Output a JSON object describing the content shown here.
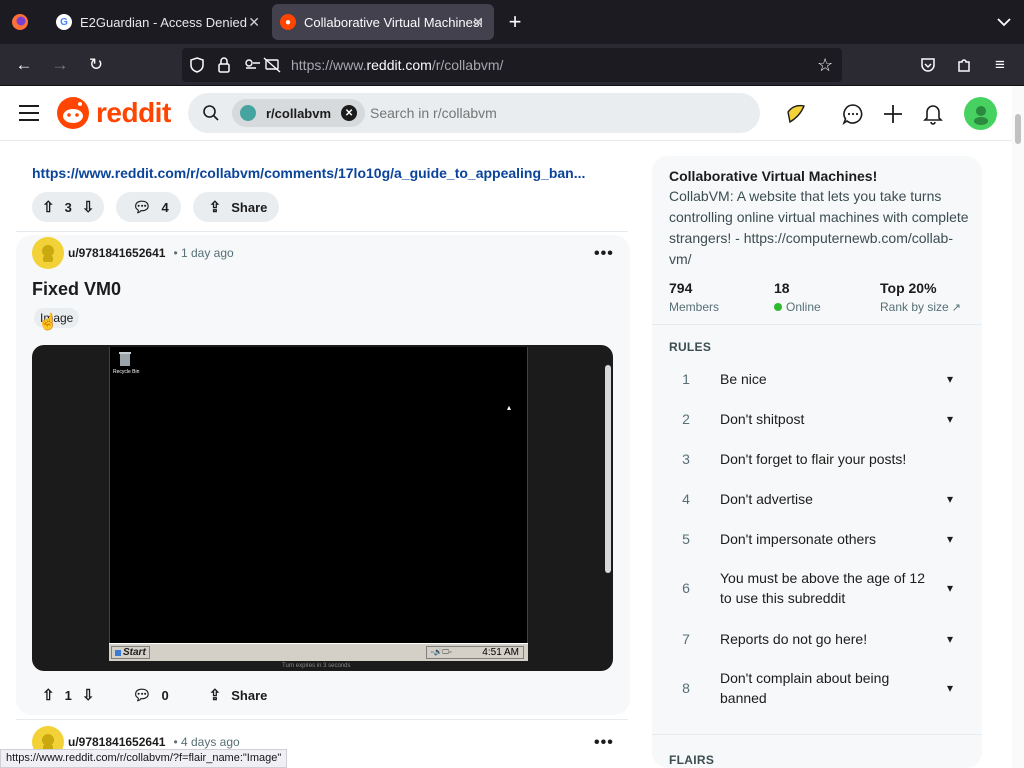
{
  "browser": {
    "tabs": [
      {
        "title": "E2Guardian - Access Denied",
        "active": false
      },
      {
        "title": "Collaborative Virtual Machines!",
        "active": true
      }
    ],
    "url": {
      "prefix": "https://www.",
      "domain": "reddit.com",
      "path": "/r/collabvm/"
    },
    "status_url": "https://www.reddit.com/r/collabvm/?f=flair_name:\"Image\""
  },
  "header": {
    "logo_text": "reddit",
    "search_chip": "r/collabvm",
    "search_placeholder": "Search in r/collabvm"
  },
  "feed": {
    "prev_post": {
      "link": "https://www.reddit.com/r/collabvm/comments/17lo10g/a_guide_to_appealing_ban...",
      "votes": "3",
      "comments": "4",
      "share": "Share"
    },
    "post": {
      "user": "u/9781841652641",
      "time": "• 1 day ago",
      "title": "Fixed VM0",
      "flair": "Image",
      "image": {
        "recycle_bin_label": "Recycle Bin",
        "start_label": "Start",
        "clock": "4:51 AM",
        "tray_icons": "▫🔊🖵▫",
        "caption": "Turn expires in 3 seconds"
      },
      "votes": "1",
      "comments": "0",
      "share": "Share"
    },
    "next_post": {
      "user": "u/9781841652641",
      "time": "• 4 days ago"
    }
  },
  "sidebar": {
    "title": "Collaborative Virtual Machines!",
    "description": "CollabVM: A website that lets you take turns controlling online virtual machines with complete strangers! - https://computernewb.com/collab-vm/",
    "stats": [
      {
        "value": "794",
        "label": "Members"
      },
      {
        "value": "18",
        "label": "Online"
      },
      {
        "value": "Top 20%",
        "label": "Rank by size"
      }
    ],
    "rules_heading": "RULES",
    "rules": [
      {
        "n": "1",
        "text": "Be nice",
        "expandable": true
      },
      {
        "n": "2",
        "text": "Don't shitpost",
        "expandable": true
      },
      {
        "n": "3",
        "text": "Don't forget to flair your posts!",
        "expandable": false
      },
      {
        "n": "4",
        "text": "Don't advertise",
        "expandable": true
      },
      {
        "n": "5",
        "text": "Don't impersonate others",
        "expandable": true
      },
      {
        "n": "6",
        "text": "You must be above the age of 12 to use this subreddit",
        "expandable": true
      },
      {
        "n": "7",
        "text": "Reports do not go here!",
        "expandable": true
      },
      {
        "n": "8",
        "text": "Don't complain about being banned",
        "expandable": true
      }
    ],
    "flairs_heading": "FLAIRS"
  },
  "colors": {
    "reddit_orange": "#ff4500",
    "link_blue": "#0a449b",
    "online_green": "#2eb82e"
  }
}
